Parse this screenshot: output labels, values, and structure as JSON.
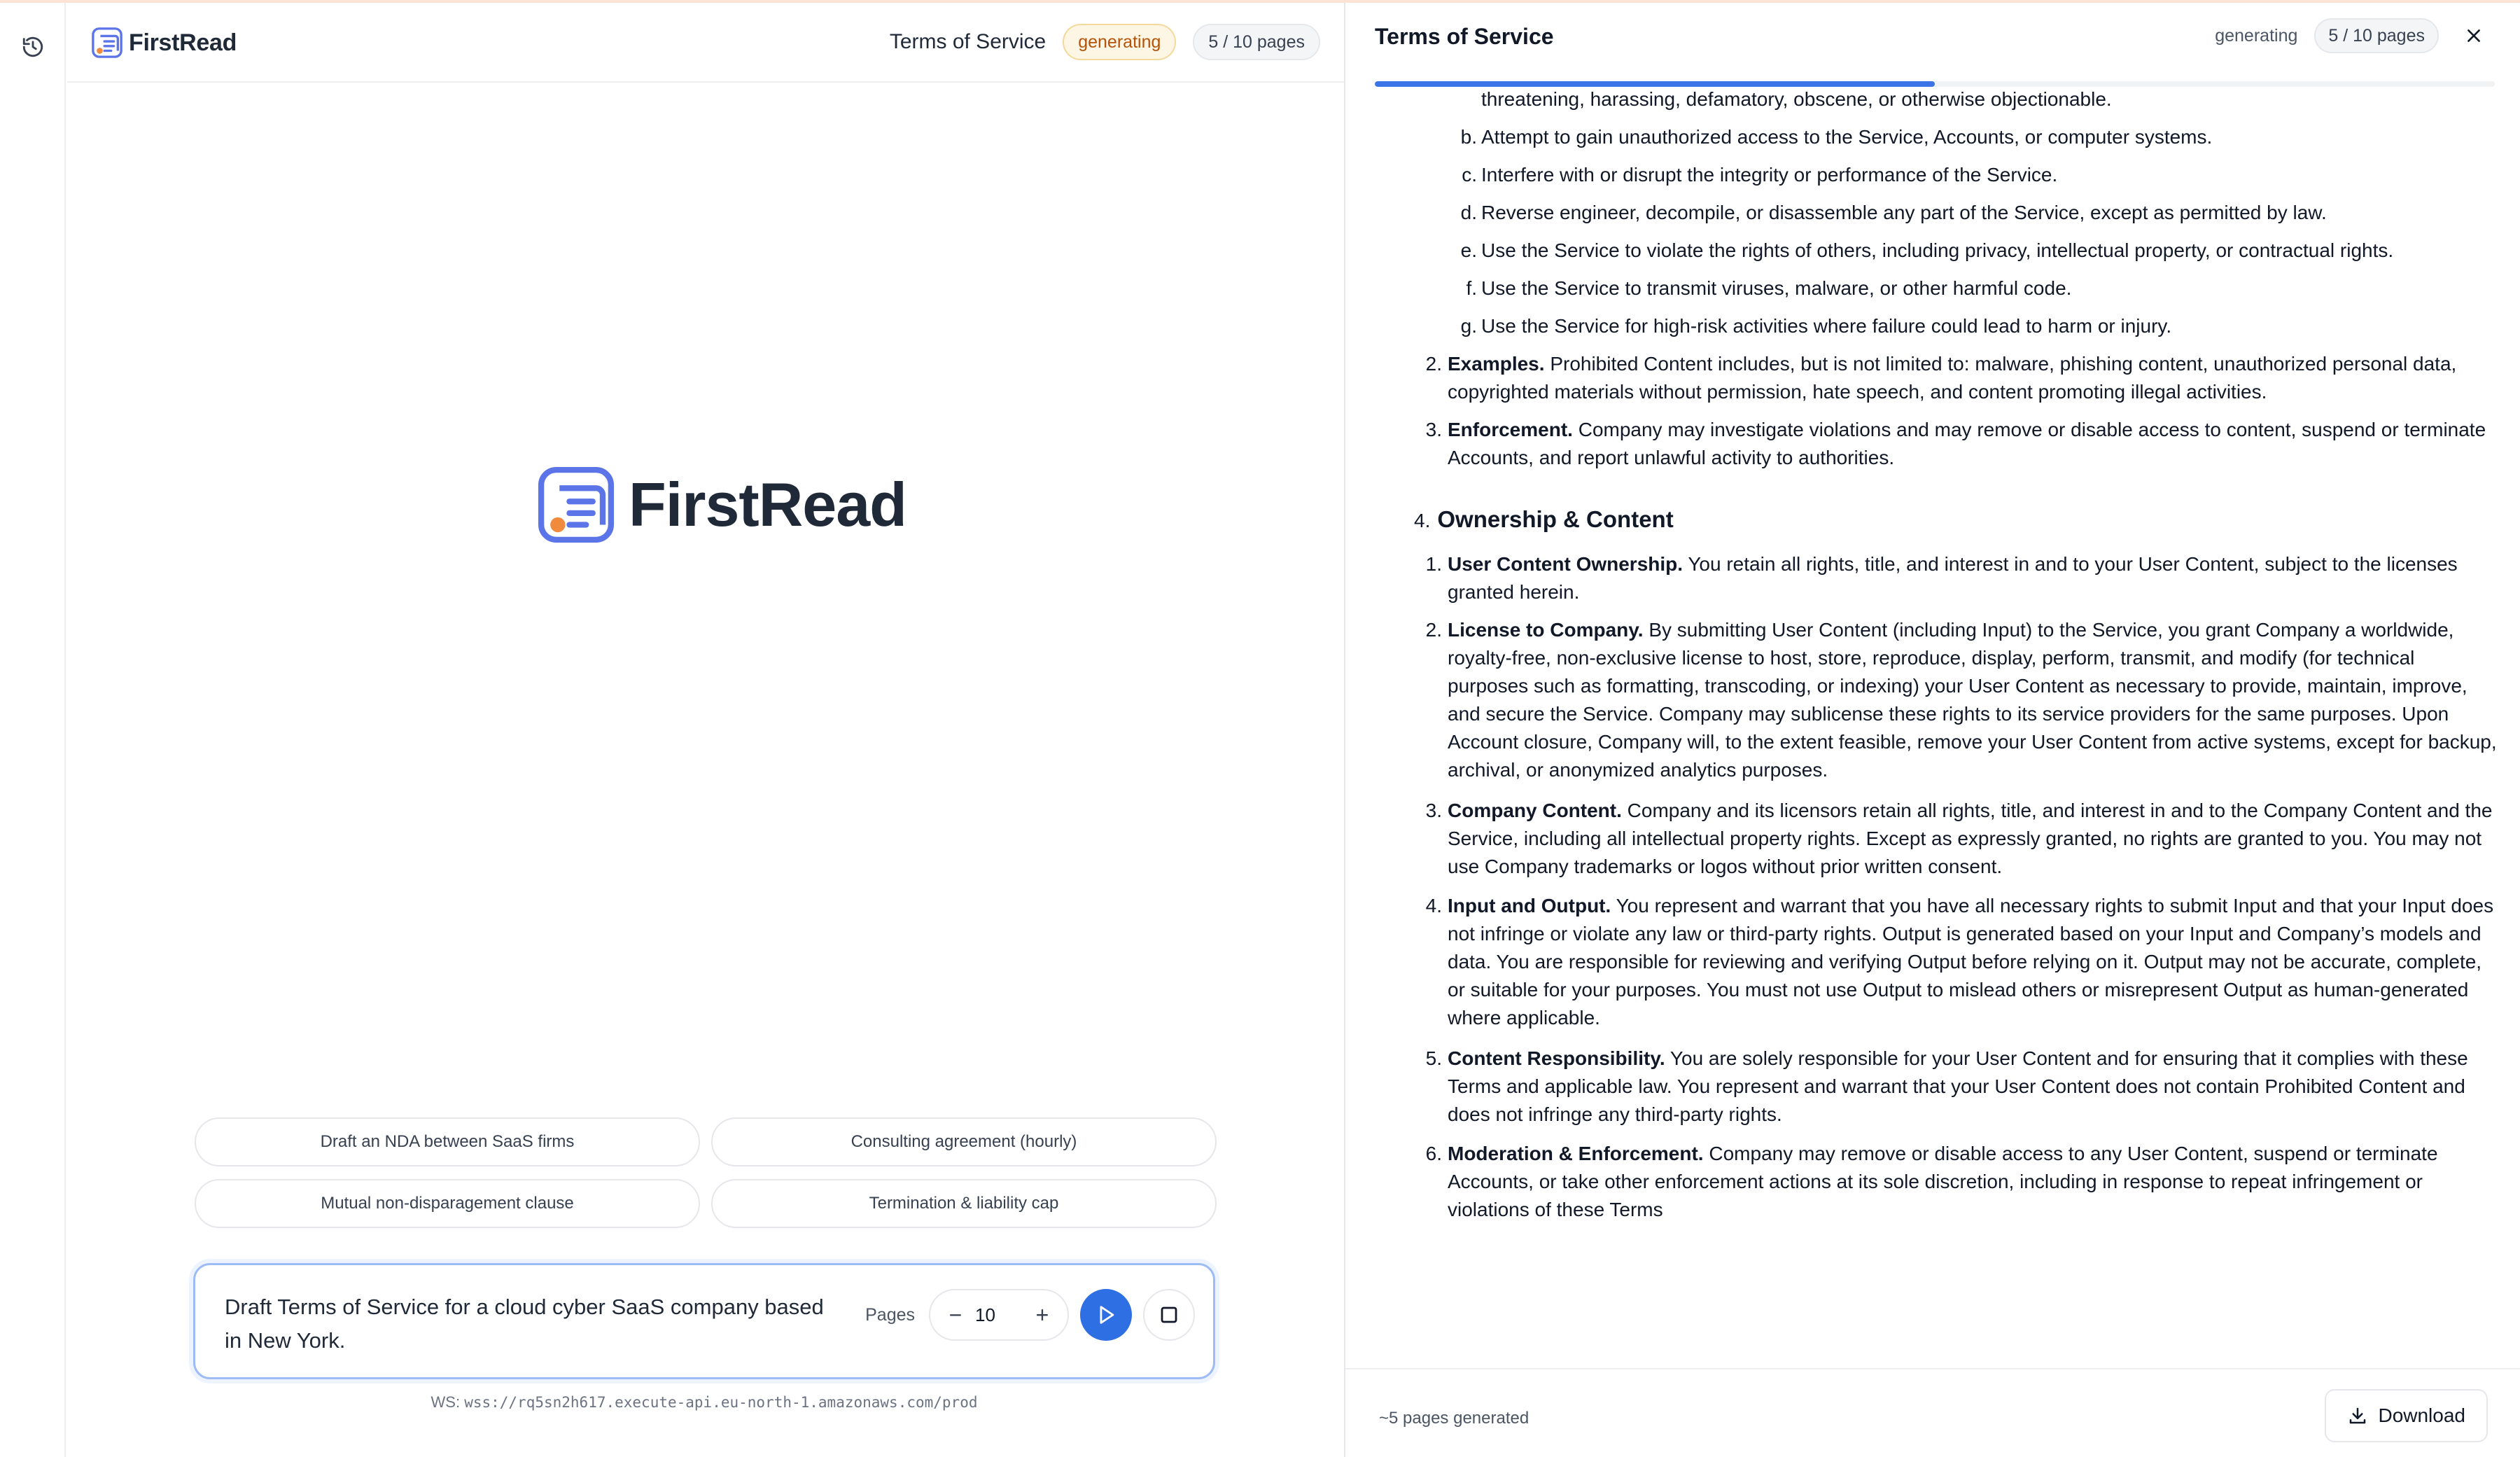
{
  "app": {
    "brand_name": "FirstRead",
    "accent_color": "#2f6fe4",
    "logo_color": "#5b74e8",
    "logo_dot_color": "#f08a3c"
  },
  "rail": {
    "history_icon": "history-icon"
  },
  "header": {
    "doc_title": "Terms of Service",
    "status": "generating",
    "pages": "5 / 10 pages"
  },
  "suggestions": [
    "Draft an NDA between SaaS firms",
    "Consulting agreement (hourly)",
    "Mutual non-disparagement clause",
    "Termination & liability cap"
  ],
  "composer": {
    "prompt": "Draft Terms of Service for a cloud cyber SaaS company based in New York.",
    "pages_label": "Pages",
    "pages_value": "10",
    "decrement": "−",
    "increment": "+"
  },
  "ws": {
    "label": "WS:",
    "url": "wss://rq5sn2h617.execute-api.eu-north-1.amazonaws.com/prod"
  },
  "document": {
    "title": "Terms of Service",
    "status": "generating",
    "pages": "5 / 10 pages",
    "progress_fraction": 0.5,
    "cut_line": "threatening, harassing, defamatory, obscene, or otherwise objectionable.",
    "sub_items": [
      {
        "marker": "b.",
        "text": "Attempt to gain unauthorized access to the Service, Accounts, or computer systems."
      },
      {
        "marker": "c.",
        "text": "Interfere with or disrupt the integrity or performance of the Service."
      },
      {
        "marker": "d.",
        "text": "Reverse engineer, decompile, or disassemble any part of the Service, except as permitted by law."
      },
      {
        "marker": "e.",
        "text": "Use the Service to violate the rights of others, including privacy, intellectual property, or contractual rights."
      },
      {
        "marker": "f.",
        "text": "Use the Service to transmit viruses, malware, or other harmful code."
      },
      {
        "marker": "g.",
        "text": "Use the Service for high-risk activities where failure could lead to harm or injury."
      }
    ],
    "items_before": [
      {
        "marker": "2.",
        "title": "Examples.",
        "text": "Prohibited Content includes, but is not limited to: malware, phishing content, unauthorized personal data, copyrighted materials without permission, hate speech, and content promoting illegal activities."
      },
      {
        "marker": "3.",
        "title": "Enforcement.",
        "text": "Company may investigate violations and may remove or disable access to content, suspend or terminate Accounts, and report unlawful activity to authorities."
      }
    ],
    "section": {
      "marker": "4.",
      "title": "Ownership & Content"
    },
    "items": [
      {
        "marker": "1.",
        "title": "User Content Ownership.",
        "text": "You retain all rights, title, and interest in and to your User Content, subject to the licenses granted herein."
      },
      {
        "marker": "2.",
        "title": "License to Company.",
        "text": "By submitting User Content (including Input) to the Service, you grant Company a worldwide, royalty-free, non-exclusive license to host, store, reproduce, display, perform, transmit, and modify (for technical purposes such as formatting, transcoding, or indexing) your User Content as necessary to provide, maintain, improve, and secure the Service. Company may sublicense these rights to its service providers for the same purposes. Upon Account closure, Company will, to the extent feasible, remove your User Content from active systems, except for backup, archival, or anonymized analytics purposes."
      },
      {
        "marker": "3.",
        "title": "Company Content.",
        "text": "Company and its licensors retain all rights, title, and interest in and to the Company Content and the Service, including all intellectual property rights. Except as expressly granted, no rights are granted to you. You may not use Company trademarks or logos without prior written consent."
      },
      {
        "marker": "4.",
        "title": "Input and Output.",
        "text": "You represent and warrant that you have all necessary rights to submit Input and that your Input does not infringe or violate any law or third-party rights. Output is generated based on your Input and Company’s models and data. You are responsible for reviewing and verifying Output before relying on it. Output may not be accurate, complete, or suitable for your purposes. You must not use Output to mislead others or misrepresent Output as human-generated where applicable."
      },
      {
        "marker": "5.",
        "title": "Content Responsibility.",
        "text": "You are solely responsible for your User Content and for ensuring that it complies with these Terms and applicable law. You represent and warrant that your User Content does not contain Prohibited Content and does not infringe any third-party rights."
      },
      {
        "marker": "6.",
        "title": "Moderation & Enforcement.",
        "text": "Company may remove or disable access to any User Content, suspend or terminate Accounts, or take other enforcement actions at its sole discretion, including in response to repeat infringement or violations of these Terms"
      }
    ]
  },
  "footer": {
    "note": "~5 pages generated",
    "download_label": "Download"
  }
}
